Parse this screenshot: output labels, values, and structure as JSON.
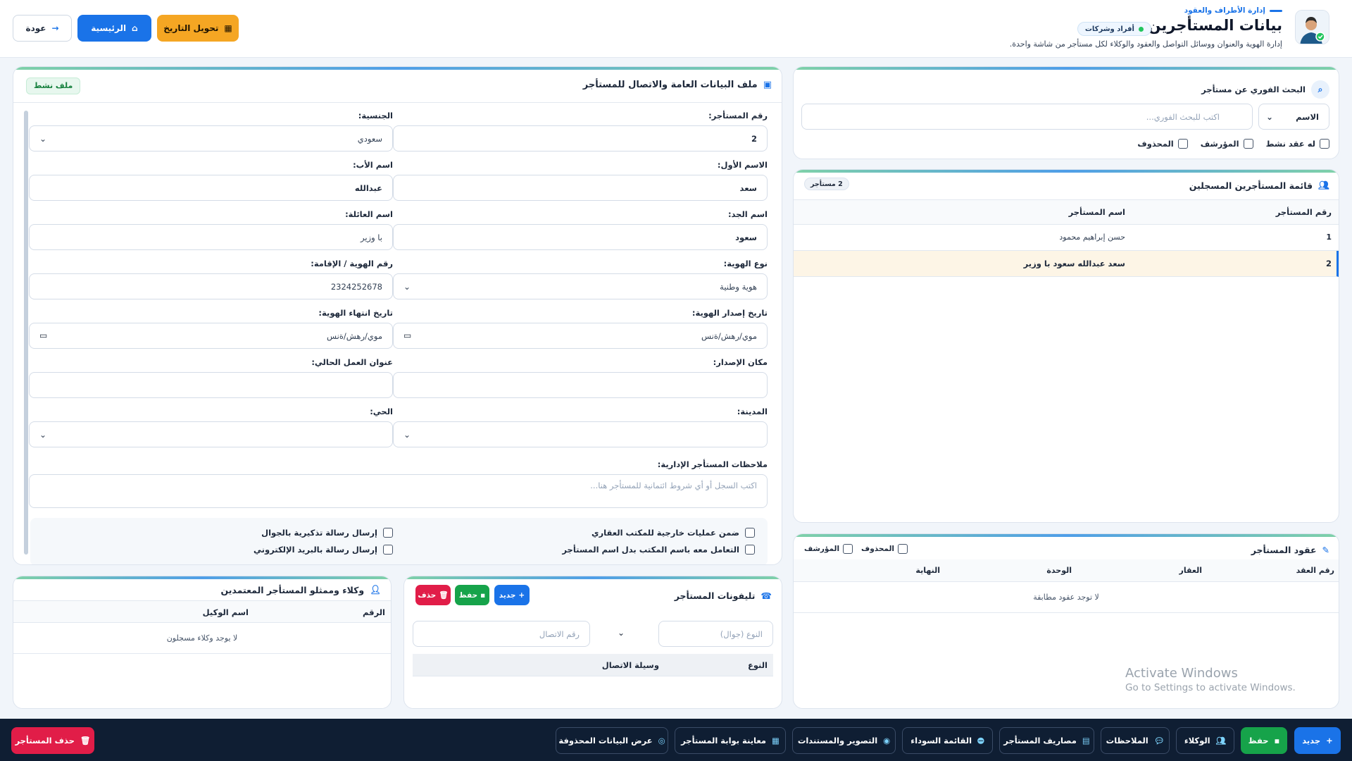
{
  "header": {
    "section_label": "إدارة الأطراف والعقود",
    "title": "بيانات المستأجرين",
    "badge": "أفراد وشركات",
    "subtitle": "إدارة الهوية والعنوان ووسائل التواصل والعقود والوكلاء لكل مستأجر من شاشة واحدة.",
    "btn_convert": "تحويل التاريخ",
    "btn_home": "الرئيسية",
    "btn_back": "عودة"
  },
  "search": {
    "title": "البحث الفوري عن مستأجر",
    "field_selected": "الاسم",
    "placeholder": "اكتب للبحث الفوري...",
    "filters": [
      "له عقد نشط",
      "المؤرشف",
      "المحذوف"
    ]
  },
  "tenant_list": {
    "title": "قائمة المستأجرين المسجلين",
    "count": "2 مستأجر",
    "columns": [
      "رقم المستأجر",
      "اسم المستأجر"
    ],
    "rows": [
      {
        "id": "1",
        "name": "حسن إبراهيم محمود"
      },
      {
        "id": "2",
        "name": "سعد عبدالله سعود با وزير"
      }
    ]
  },
  "contracts": {
    "title": "عقود المستأجر",
    "filters": [
      "المحذوف",
      "المؤرشف"
    ],
    "columns": [
      "رقم العقد",
      "العقار",
      "الوحدة",
      "النهاية"
    ],
    "empty": "لا توجد عقود مطابقة"
  },
  "profile": {
    "title": "ملف البيانات العامة والاتصال للمستأجر",
    "status": "ملف نشط",
    "fields": {
      "tenant_no": {
        "label": "رقم المستأجر:",
        "value": "2"
      },
      "nationality": {
        "label": "الجنسية:",
        "value": "سعودي"
      },
      "first_name": {
        "label": "الاسم الأول:",
        "value": "سعد"
      },
      "father_name": {
        "label": "اسم الأب:",
        "value": "عبدالله"
      },
      "grandfather_name": {
        "label": "اسم الجد:",
        "value": "سعود"
      },
      "family_name": {
        "label": "اسم العائلة:",
        "value": "با وزير"
      },
      "id_type": {
        "label": "نوع الهوية:",
        "value": "هوية وطنية"
      },
      "id_no": {
        "label": "رقم الهوية / الإقامة:",
        "value": "2324252678"
      },
      "issue_date": {
        "label": "تاريخ إصدار الهوية:",
        "value": "موي/رهش/ةنس"
      },
      "expiry_date": {
        "label": "تاريخ انتهاء الهوية:",
        "value": "موي/رهش/ةنس"
      },
      "issue_place": {
        "label": "مكان الإصدار:",
        "value": ""
      },
      "work_address": {
        "label": "عنوان العمل الحالي:",
        "value": ""
      },
      "city": {
        "label": "المدينة:",
        "value": ""
      },
      "district": {
        "label": "الحي:",
        "value": ""
      },
      "notes": {
        "label": "ملاحظات المستأجر الإدارية:",
        "placeholder": "اكتب السجل أو أي شروط ائتمانية للمستأجر هنا..."
      }
    },
    "checkboxes": [
      "ضمن عمليات خارجية للمكتب العقاري",
      "إرسال رسالة تذكيرية بالجوال",
      "التعامل معه باسم المكتب بدل اسم المستأجر",
      "إرسال رسالة بالبريد الإلكتروني"
    ]
  },
  "phones": {
    "title": "تليفونات المستأجر",
    "btn_new": "جديد",
    "btn_save": "حفظ",
    "btn_delete": "حذف",
    "type_placeholder": "النوع (جوال)",
    "number_placeholder": "رقم الاتصال",
    "columns": [
      "النوع",
      "وسيلة الاتصال"
    ]
  },
  "agents": {
    "title": "وكلاء وممثلو المستأجر المعتمدين",
    "columns": [
      "الرقم",
      "اسم الوكيل"
    ],
    "empty": "لا يوجد وكلاء مسجلون"
  },
  "watermark": {
    "line1": "Activate Windows",
    "line2": "Go to Settings to activate Windows."
  },
  "footer": {
    "new": "جديد",
    "save": "حفظ",
    "agents": "الوكلاء",
    "notes": "الملاحظات",
    "expenses": "مصاريف المستأجر",
    "blacklist": "القائمة السوداء",
    "scan": "التصوير والمستندات",
    "portal": "معاينة بوابة المستأجر",
    "deleted": "عرض البيانات المحذوفة",
    "delete_tenant": "حذف المستأجر"
  },
  "colors": {
    "accent": "#1a73e8",
    "orange": "#f59e0b",
    "green": "#15a34a",
    "red": "#e11d48",
    "navy": "#0f1e33"
  }
}
